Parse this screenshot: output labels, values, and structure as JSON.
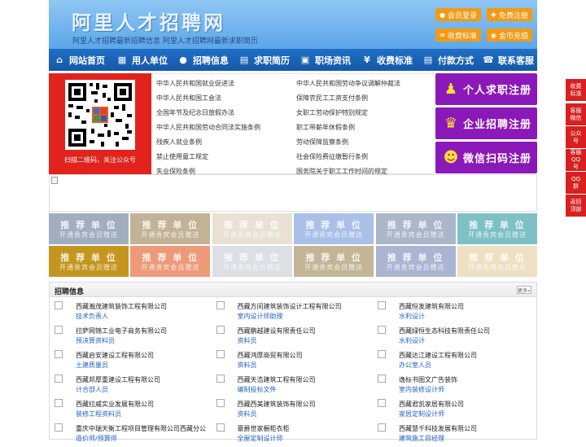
{
  "header": {
    "title": "阿里人才招聘网",
    "subtitle": "阿里人才招聘最新招聘信息   阿里人才招聘网最新求职简历",
    "buttons": [
      {
        "label": "会员登录",
        "icon": "user-icon"
      },
      {
        "label": "免费注册",
        "icon": "user-add-icon"
      },
      {
        "label": "收费标准",
        "icon": "mail-icon"
      },
      {
        "label": "金币充值",
        "icon": "coin-icon"
      }
    ]
  },
  "nav": [
    {
      "label": "网站首页",
      "icon": "home-icon"
    },
    {
      "label": "用人单位",
      "icon": "building-icon"
    },
    {
      "label": "招聘信息",
      "icon": "chat-icon"
    },
    {
      "label": "求职简历",
      "icon": "document-icon"
    },
    {
      "label": "职场资讯",
      "icon": "news-icon"
    },
    {
      "label": "收费标准",
      "icon": "yen-icon"
    },
    {
      "label": "付款方式",
      "icon": "card-icon"
    },
    {
      "label": "联系客服",
      "icon": "phone-icon"
    }
  ],
  "qr": {
    "caption": "扫描二维码，关注公众号"
  },
  "laws_left": [
    "中华人民共和国就业促进法",
    "中华人民共和国工会法",
    "全国年节及纪念日放假办法",
    "中华人民共和国劳动合同法实施条例",
    "残疾人就业条例",
    "禁止使用童工规定",
    "失业保险条例"
  ],
  "laws_right": [
    "中华人民共和国劳动争议调解仲裁法",
    "保障农民工工资支付条例",
    "女职工劳动保护特别规定",
    "职工带薪年休假条例",
    "劳动保障监察条例",
    "社会保险费征缴暂行条例",
    "国务院关于职工工作时间的规定"
  ],
  "register": [
    {
      "label": "个人求职注册",
      "icon": "person-icon"
    },
    {
      "label": "企业招聘注册",
      "icon": "company-icon"
    },
    {
      "label": "微信扫码注册",
      "icon": "wechat-icon"
    }
  ],
  "tiles": {
    "title": "推 荐 单 位",
    "sub": "开通贵宾会员赠送",
    "colors_row1": [
      "#a1aec0",
      "#c3b396",
      "#e9e1d3",
      "#a9c0e8",
      "#aab7c9",
      "#7ec0c5"
    ],
    "colors_row2": [
      "#c4961f",
      "#ed9a7a",
      "#dcdfe3",
      "#c3b696",
      "#aab5d4",
      "#eee0c3"
    ]
  },
  "jobs": {
    "title": "招聘信息",
    "more": "更多»",
    "rows": [
      [
        {
          "company": "西藏瀚茂建筑装饰工程有限公司",
          "position": "技术负责人"
        },
        {
          "company": "西藏方间建筑装饰设计工程有限公司",
          "position": "室内设计师助理"
        },
        {
          "company": "西藏恒发建筑有限公司",
          "position": "水利设计"
        }
      ],
      [
        {
          "company": "拉萨网锦工业电子商务有限公司",
          "position": "预决算资料员"
        },
        {
          "company": "西藏鹏越建设有限责任公司",
          "position": "资料员"
        },
        {
          "company": "西藏绿恒生态科技有限责任公司",
          "position": "水利设计"
        }
      ],
      [
        {
          "company": "西藏启安建设工程有限公司",
          "position": "土建质量员"
        },
        {
          "company": "西藏鸿厚商贸有限公司",
          "position": "资料员"
        },
        {
          "company": "西藏达江建设工程有限公司",
          "position": "办公室人员"
        }
      ],
      [
        {
          "company": "西藏邦厚重建设工程有限公司",
          "position": "计合部人员"
        },
        {
          "company": "西藏天浩建筑工程有限公司",
          "position": "编制投标文件"
        },
        {
          "company": "逸标书图文广告装饰",
          "position": "室内装修设计师"
        }
      ],
      [
        {
          "company": "西藏拉威实业发展有限公司",
          "position": "装修工程资料员"
        },
        {
          "company": "西藏西美建筑装饰有限公司",
          "position": "资料员"
        },
        {
          "company": "西藏君凯家居有限公司",
          "position": "家居定制设计师"
        }
      ],
      [
        {
          "company": "重庆中瑞天衡工程项目管理有限公司西藏分公",
          "position": "造价师/预算师"
        },
        {
          "company": "豪爵世家橱柜衣柜",
          "position": "全屋定制设计师"
        },
        {
          "company": "西藏慧千科技发展有限公司",
          "position": "建筑施工目经理"
        }
      ]
    ]
  },
  "float": [
    "收费标准",
    "客服微信",
    "公众号",
    "客服QQ号",
    "QQ群",
    "返回顶部"
  ]
}
